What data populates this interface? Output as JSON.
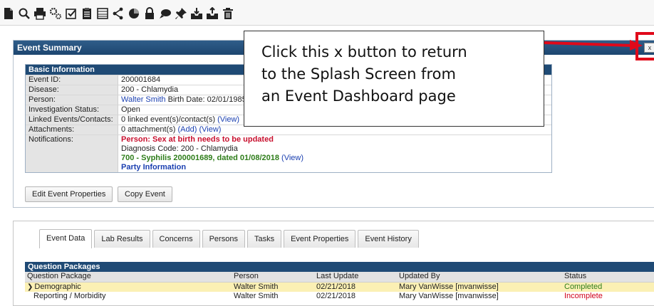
{
  "toolbar": {
    "icons": [
      "document-icon",
      "search-icon",
      "print-icon",
      "gears-icon",
      "checklist-icon",
      "clipboard-icon",
      "table-icon",
      "share-icon",
      "pie-chart-icon",
      "lock-icon",
      "comment-icon",
      "pin-icon",
      "tray-in-icon",
      "tray-out-icon",
      "trash-icon"
    ]
  },
  "summary": {
    "title": "Event Summary",
    "close_label": "x"
  },
  "basic": {
    "header": "Basic Information",
    "rows": [
      {
        "label": "Event ID:",
        "value": "200001684"
      },
      {
        "label": "Disease:",
        "value": "200 - Chlamydia"
      },
      {
        "label": "Person:",
        "link": "Walter Smith",
        "extra": "Birth Date: 02/01/1985"
      },
      {
        "label": "Investigation Status:",
        "value": "Open"
      },
      {
        "label": "Linked Events/Contacts:",
        "value": "0 linked event(s)/contact(s)",
        "link1": "(View)"
      },
      {
        "label": "Attachments:",
        "value": "0 attachment(s)",
        "link1": "(Add)",
        "link2": "(View)"
      },
      {
        "label": "Notifications:"
      }
    ],
    "notifications": {
      "line1": "Person: Sex at birth needs to be updated",
      "line2": "Diagnosis Code: 200 - Chlamydia",
      "line3": "700 - Syphilis 200001689, dated 01/08/2018",
      "line3_link": "(View)",
      "line4": "Party Information"
    }
  },
  "buttons": {
    "edit": "Edit Event Properties",
    "copy": "Copy Event"
  },
  "callout": {
    "lines": [
      "Click this x button to return",
      "to the Splash Screen from",
      "an Event Dashboard page"
    ]
  },
  "tabs": [
    "Event Data",
    "Lab Results",
    "Concerns",
    "Persons",
    "Tasks",
    "Event Properties",
    "Event History"
  ],
  "questions": {
    "header": "Question Packages",
    "columns": [
      "Question Package",
      "Person",
      "Last Update",
      "Updated By",
      "Status"
    ],
    "rows": [
      [
        "Demographic",
        "Walter Smith",
        "02/21/2018",
        "Mary VanWisse [mvanwisse]",
        "Completed"
      ],
      [
        "Reporting / Morbidity",
        "Walter Smith",
        "02/21/2018",
        "Mary VanWisse [mvanwisse]",
        "Incomplete"
      ]
    ]
  },
  "colors": {
    "header_blue": "#1f4a75",
    "highlight_red": "#e0091a",
    "selected_row": "#fbf0b4"
  }
}
